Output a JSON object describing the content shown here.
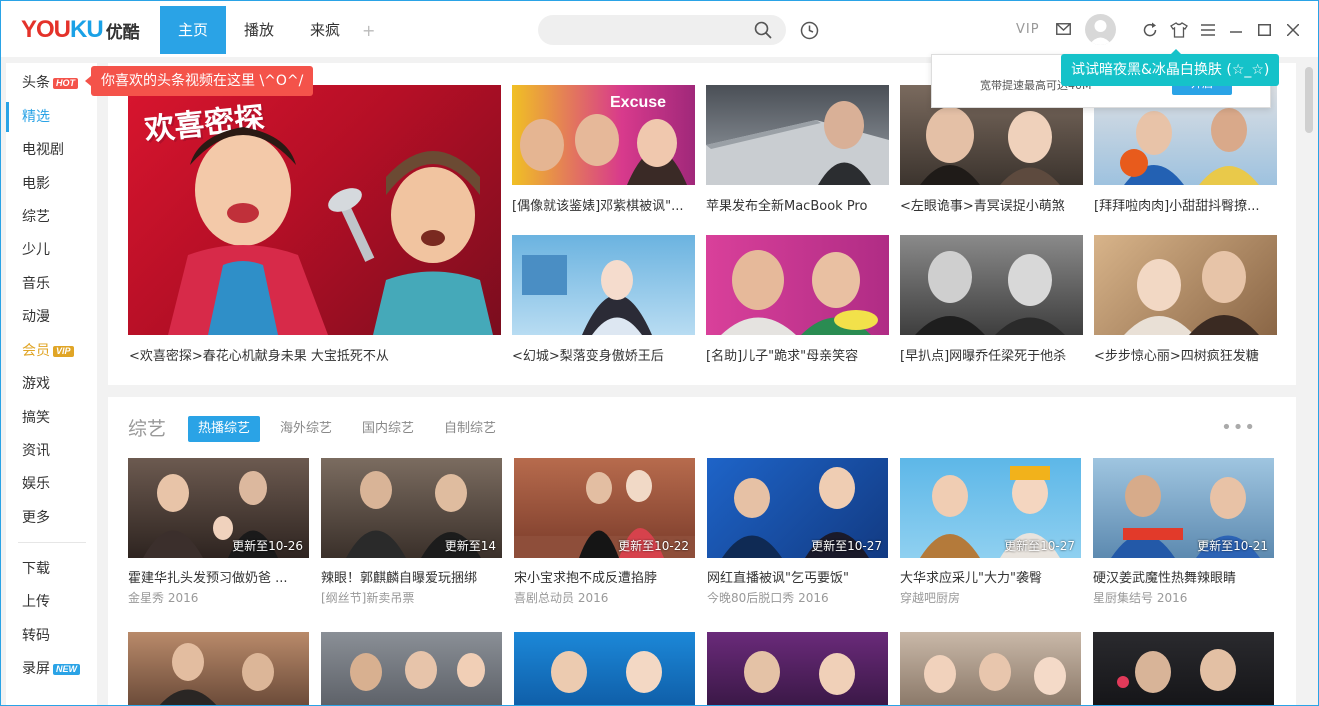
{
  "app": {
    "logo_en_1": "YOU",
    "logo_en_2": "KU",
    "logo_cn": "优酷"
  },
  "nav": {
    "tabs": [
      {
        "label": "主页",
        "active": true
      },
      {
        "label": "播放",
        "active": false
      },
      {
        "label": "来疯",
        "active": false
      }
    ],
    "plus": "+"
  },
  "search": {
    "placeholder": "",
    "value": ""
  },
  "header": {
    "vip": "VIP"
  },
  "sidebar": {
    "items": [
      {
        "label": "头条",
        "badge": "HOT"
      },
      {
        "label": "精选",
        "active": true
      },
      {
        "label": "电视剧"
      },
      {
        "label": "电影"
      },
      {
        "label": "综艺"
      },
      {
        "label": "少儿"
      },
      {
        "label": "音乐"
      },
      {
        "label": "动漫"
      },
      {
        "label": "会员",
        "badge": "VIP"
      },
      {
        "label": "游戏"
      },
      {
        "label": "搞笑"
      },
      {
        "label": "资讯"
      },
      {
        "label": "娱乐"
      },
      {
        "label": "更多"
      },
      {
        "label": "下载"
      },
      {
        "label": "上传"
      },
      {
        "label": "转码"
      },
      {
        "label": "录屏",
        "badge": "NEW"
      }
    ]
  },
  "tips": {
    "headline": "你喜欢的头条视频在这里 \\^O^/",
    "speed_text": "宽带提速最高可达40M",
    "speed_button": "开启",
    "skin": "试试暗夜黑&冰晶白换肤 (☆_☆)"
  },
  "featured": {
    "hero": {
      "caption": "<欢喜密探>春花心机献身未果 大宝抵死不从",
      "art_title": "欢喜密探"
    },
    "items": [
      {
        "caption": "[偶像就该鉴婊]邓紫棋被讽\"..."
      },
      {
        "caption": "苹果发布全新MacBook Pro"
      },
      {
        "caption": "<左眼诡事>青冥误捉小萌煞"
      },
      {
        "caption": "[拜拜啦肉肉]小甜甜抖臀撩..."
      },
      {
        "caption": "<幻城>梨落变身傲娇王后"
      },
      {
        "caption": "[名助]儿子\"跪求\"母亲笑容"
      },
      {
        "caption": "[早扒点]网曝乔任梁死于他杀"
      },
      {
        "caption": "<步步惊心丽>四树疯狂发糖"
      }
    ]
  },
  "variety": {
    "title": "综艺",
    "tabs": [
      {
        "label": "热播综艺",
        "active": true
      },
      {
        "label": "海外综艺"
      },
      {
        "label": "国内综艺"
      },
      {
        "label": "自制综艺"
      }
    ],
    "more": "•••",
    "items": [
      {
        "update": "更新至10-26",
        "caption": "霍建华扎头发预习做奶爸 ...",
        "sub": "金星秀 2016"
      },
      {
        "update": "更新至14",
        "caption": "辣眼！郭麒麟自曝爱玩捆绑",
        "sub": "[纲丝节]新卖吊票"
      },
      {
        "update": "更新至10-22",
        "caption": "宋小宝求抱不成反遭掐脖",
        "sub": "喜剧总动员 2016"
      },
      {
        "update": "更新至10-27",
        "caption": "网红直播被讽\"乞丐要饭\"",
        "sub": "今晚80后脱口秀 2016"
      },
      {
        "update": "更新至10-27",
        "caption": "大华求应采儿\"大力\"袭臀",
        "sub": "穿越吧厨房"
      },
      {
        "update": "更新至10-21",
        "caption": "硬汉姜武魔性热舞辣眼睛",
        "sub": "星厨集结号 2016"
      }
    ]
  },
  "colors": {
    "accent": "#2aa3e6",
    "hot": "#f4534a",
    "vip": "#e0a526",
    "teal": "#15c2c9"
  }
}
